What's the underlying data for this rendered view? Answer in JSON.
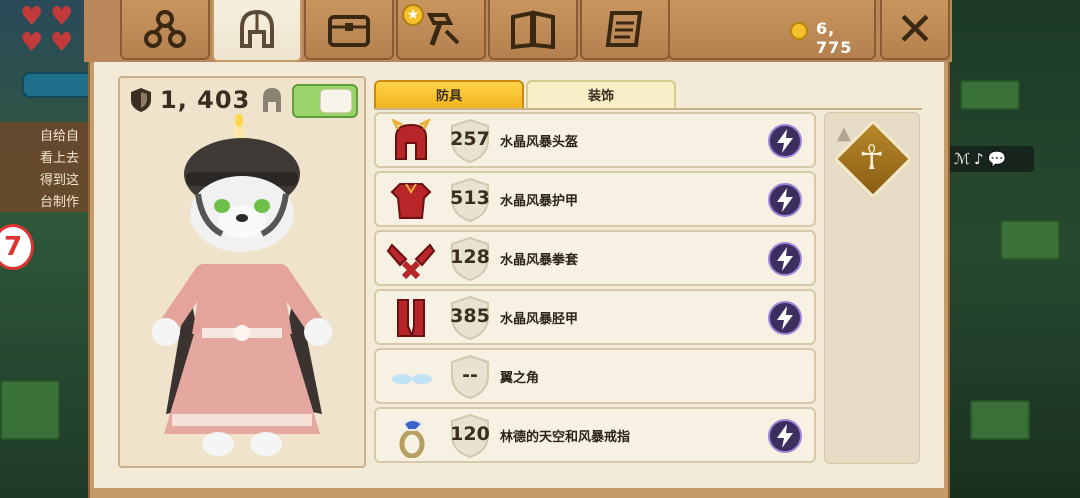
{
  "header": {
    "tabs": [
      {
        "name": "tab-skill-tree",
        "icon": "nodes-icon",
        "active": false
      },
      {
        "name": "tab-equipment",
        "icon": "helmet-icon",
        "active": true
      },
      {
        "name": "tab-backpack",
        "icon": "chest-icon",
        "active": false
      },
      {
        "name": "tab-crafting",
        "icon": "hammer-icon",
        "active": false,
        "badge": "star-icon"
      },
      {
        "name": "tab-codex",
        "icon": "book-icon",
        "active": false
      },
      {
        "name": "tab-quests",
        "icon": "scroll-icon",
        "active": false
      }
    ],
    "coins": "6, 775",
    "close_label": "✕"
  },
  "character": {
    "armor_total": "1, 403",
    "show_helmet": true
  },
  "subtabs": {
    "armor_label": "防具",
    "decor_label": "装饰"
  },
  "items": [
    {
      "value": "257",
      "name": "水晶风暴头盔",
      "icon": "red-helmet-icon",
      "upgrade": true
    },
    {
      "value": "513",
      "name": "水晶风暴护甲",
      "icon": "red-armor-icon",
      "upgrade": true
    },
    {
      "value": "128",
      "name": "水晶风暴拳套",
      "icon": "red-gauntlets-icon",
      "upgrade": true
    },
    {
      "value": "385",
      "name": "水晶风暴胫甲",
      "icon": "red-greaves-icon",
      "upgrade": true
    },
    {
      "value": "--",
      "name": "翼之角",
      "icon": "wing-horn-icon",
      "upgrade": false
    },
    {
      "value": "120",
      "name": "林德的天空和风暴戒指",
      "icon": "ring-icon",
      "upgrade": true
    }
  ],
  "left_note": [
    "自给自",
    "看上去",
    "得到这",
    "台制作"
  ],
  "colors": {
    "panel": "#f3ead7",
    "tab_active": "#f0b41b",
    "upgrade_bolt": "#3c2e5e"
  }
}
